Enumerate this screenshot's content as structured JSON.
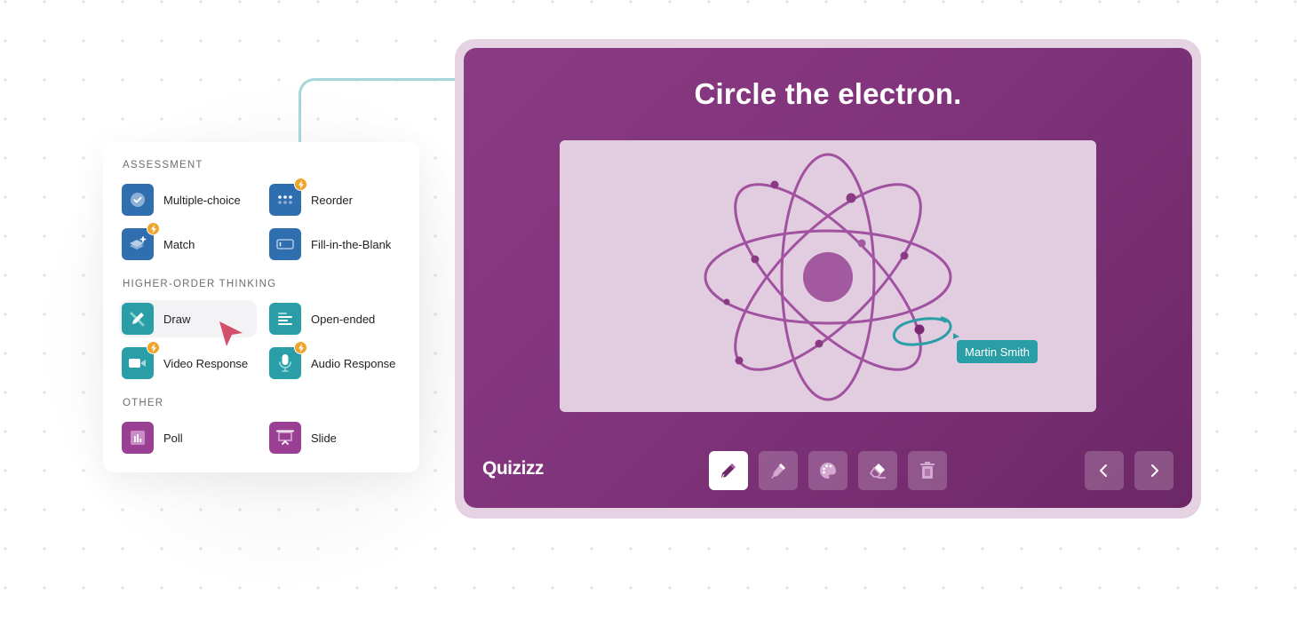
{
  "menu": {
    "sections": [
      {
        "label": "ASSESSMENT",
        "items": [
          {
            "label": "Multiple-choice",
            "icon": "check-circle-icon",
            "color": "#2f6fb0",
            "premium": false
          },
          {
            "label": "Reorder",
            "icon": "dots-grid-icon",
            "color": "#2f6fb0",
            "premium": true
          },
          {
            "label": "Match",
            "icon": "layers-plus-icon",
            "color": "#2f6fb0",
            "premium": true
          },
          {
            "label": "Fill-in-the-Blank",
            "icon": "text-box-icon",
            "color": "#2f6fb0",
            "premium": false
          }
        ]
      },
      {
        "label": "HIGHER-ORDER THINKING",
        "items": [
          {
            "label": "Draw",
            "icon": "pencil-ruler-icon",
            "color": "#2a9ea6",
            "premium": false,
            "hovered": true
          },
          {
            "label": "Open-ended",
            "icon": "text-lines-icon",
            "color": "#2a9ea6",
            "premium": false
          },
          {
            "label": "Video Response",
            "icon": "video-camera-icon",
            "color": "#2a9ea6",
            "premium": true
          },
          {
            "label": "Audio Response",
            "icon": "microphone-icon",
            "color": "#2a9ea6",
            "premium": true
          }
        ]
      },
      {
        "label": "OTHER",
        "items": [
          {
            "label": "Poll",
            "icon": "bar-chart-icon",
            "color": "#9a3f94",
            "premium": false
          },
          {
            "label": "Slide",
            "icon": "presentation-icon",
            "color": "#9a3f94",
            "premium": false
          }
        ]
      }
    ]
  },
  "slide": {
    "question": "Circle the electron.",
    "participant_tag": "Martin Smith",
    "logo": "Quizizz",
    "tools": [
      {
        "name": "pencil",
        "icon": "pencil-icon",
        "active": true
      },
      {
        "name": "highlighter",
        "icon": "marker-icon",
        "active": false
      },
      {
        "name": "colors",
        "icon": "palette-icon",
        "active": false
      },
      {
        "name": "eraser",
        "icon": "eraser-icon",
        "active": false
      },
      {
        "name": "clear",
        "icon": "trash-icon",
        "active": false
      }
    ],
    "nav": {
      "prev": "chevron-left-icon",
      "next": "chevron-right-icon"
    }
  },
  "colors": {
    "accent_teal": "#2a9ea6",
    "brand_purple": "#8a3a82",
    "premium_bolt": "#efa42b",
    "cursor": "#d4506a"
  }
}
